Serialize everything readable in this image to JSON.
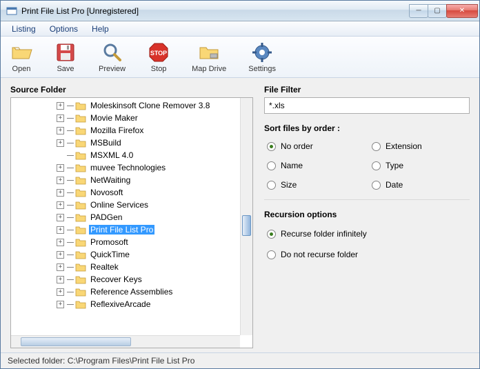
{
  "title": "Print File List Pro [Unregistered]",
  "menu": {
    "listing": "Listing",
    "options": "Options",
    "help": "Help"
  },
  "toolbar": {
    "open": "Open",
    "save": "Save",
    "preview": "Preview",
    "stop": "Stop",
    "mapdrive": "Map Drive",
    "settings": "Settings"
  },
  "left": {
    "heading": "Source Folder",
    "nodes": [
      {
        "label": "Moleskinsoft Clone Remover 3.8",
        "expandable": true
      },
      {
        "label": "Movie Maker",
        "expandable": true
      },
      {
        "label": "Mozilla Firefox",
        "expandable": true
      },
      {
        "label": "MSBuild",
        "expandable": true
      },
      {
        "label": "MSXML 4.0",
        "expandable": false
      },
      {
        "label": "muvee Technologies",
        "expandable": true
      },
      {
        "label": "NetWaiting",
        "expandable": true
      },
      {
        "label": "Novosoft",
        "expandable": true
      },
      {
        "label": "Online Services",
        "expandable": true
      },
      {
        "label": "PADGen",
        "expandable": true
      },
      {
        "label": "Print File List Pro",
        "expandable": true,
        "selected": true
      },
      {
        "label": "Promosoft",
        "expandable": true
      },
      {
        "label": "QuickTime",
        "expandable": true
      },
      {
        "label": "Realtek",
        "expandable": true
      },
      {
        "label": "Recover Keys",
        "expandable": true
      },
      {
        "label": "Reference Assemblies",
        "expandable": true
      },
      {
        "label": "ReflexiveArcade",
        "expandable": true
      }
    ]
  },
  "filter": {
    "heading": "File Filter",
    "value": "*.xls"
  },
  "sort": {
    "heading": "Sort files by order :",
    "options": {
      "noorder": "No order",
      "extension": "Extension",
      "name": "Name",
      "type": "Type",
      "size": "Size",
      "date": "Date"
    },
    "selected": "noorder"
  },
  "recursion": {
    "heading": "Recursion options",
    "options": {
      "infinite": "Recurse folder infinitely",
      "none": "Do not recurse folder"
    },
    "selected": "infinite"
  },
  "status": "Selected folder: C:\\Program Files\\Print File List Pro"
}
